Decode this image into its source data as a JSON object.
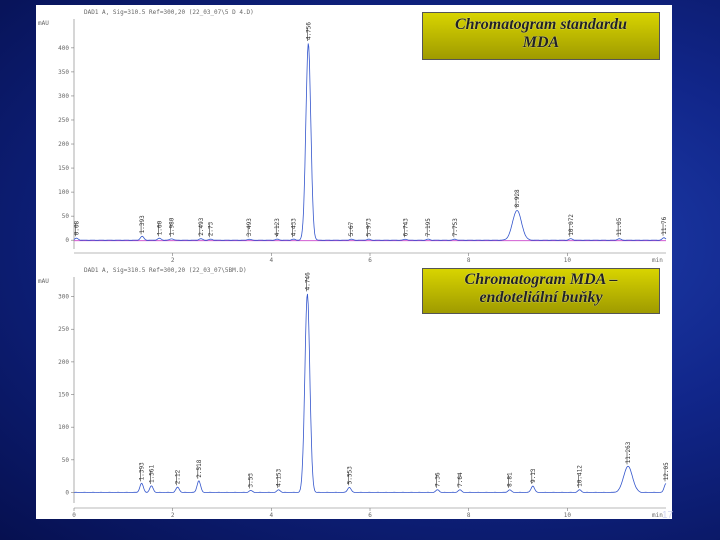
{
  "chart_data": [
    {
      "type": "line",
      "header": "DAD1 A, Sig=310.5 Ref=300,20 (22_03_07\\5 D 4.D)",
      "ylabel": "mAU",
      "yticks": [
        0,
        50,
        100,
        150,
        200,
        250,
        300,
        350,
        400
      ],
      "ylim": [
        -10,
        460
      ],
      "xticks": [
        2,
        4,
        6,
        8,
        10
      ],
      "xlim": [
        0,
        12
      ],
      "xunit": "min",
      "baseline_color": "#cc44cc",
      "series": [
        {
          "color": "#3355cc",
          "peaks": [
            {
              "rt": 0.05,
              "height": 4,
              "label": "0.08"
            },
            {
              "rt": 1.38,
              "height": 8,
              "label": "1.393"
            },
            {
              "rt": 1.73,
              "height": 4,
              "label": "1.60"
            },
            {
              "rt": 1.98,
              "height": 3,
              "label": "1.980"
            },
            {
              "rt": 2.57,
              "height": 3,
              "label": "2.493"
            },
            {
              "rt": 2.77,
              "height": 2,
              "label": "2.73"
            },
            {
              "rt": 3.55,
              "height": 2,
              "label": "3.493"
            },
            {
              "rt": 4.12,
              "height": 2,
              "label": "4.123"
            },
            {
              "rt": 4.45,
              "height": 2,
              "label": "4.433"
            },
            {
              "rt": 4.75,
              "height": 410,
              "label": "4.756"
            },
            {
              "rt": 5.62,
              "height": 2,
              "label": "5.67"
            },
            {
              "rt": 5.97,
              "height": 2,
              "label": "5.973"
            },
            {
              "rt": 6.72,
              "height": 2,
              "label": "6.743"
            },
            {
              "rt": 7.18,
              "height": 2,
              "label": "7.195"
            },
            {
              "rt": 7.72,
              "height": 2,
              "label": "7.753"
            },
            {
              "rt": 8.98,
              "height": 62,
              "label": "8.928"
            },
            {
              "rt": 10.07,
              "height": 3,
              "label": "10.072"
            },
            {
              "rt": 11.05,
              "height": 3,
              "label": "11.05"
            },
            {
              "rt": 11.96,
              "height": 5,
              "label": "11.76"
            }
          ]
        }
      ],
      "caption_lines": [
        "Chromatogram standardu",
        "MDA"
      ]
    },
    {
      "type": "line",
      "header": "DAD1 A, Sig=310.5 Ref=300,20 (22_03_07\\5BM.D)",
      "ylabel": "mAU",
      "yticks": [
        0,
        50,
        100,
        150,
        200,
        250,
        300
      ],
      "ylim": [
        -10,
        330
      ],
      "xticks": [
        0,
        2,
        4,
        6,
        8,
        10
      ],
      "xlim": [
        0,
        12
      ],
      "xunit": "min",
      "series": [
        {
          "color": "#3355cc",
          "peaks": [
            {
              "rt": 1.37,
              "height": 14,
              "label": "1.393"
            },
            {
              "rt": 1.57,
              "height": 10,
              "label": "1.561"
            },
            {
              "rt": 2.1,
              "height": 8,
              "label": "2.12"
            },
            {
              "rt": 2.53,
              "height": 18,
              "label": "2.518"
            },
            {
              "rt": 3.58,
              "height": 3,
              "label": "3.53"
            },
            {
              "rt": 4.15,
              "height": 4,
              "label": "4.153"
            },
            {
              "rt": 4.73,
              "height": 305,
              "label": "4.746"
            },
            {
              "rt": 5.58,
              "height": 8,
              "label": "5.553"
            },
            {
              "rt": 7.37,
              "height": 4,
              "label": "7.36"
            },
            {
              "rt": 7.82,
              "height": 4,
              "label": "7.64"
            },
            {
              "rt": 8.83,
              "height": 4,
              "label": "8.81"
            },
            {
              "rt": 9.3,
              "height": 10,
              "label": "9.13"
            },
            {
              "rt": 10.25,
              "height": 4,
              "label": "10.412"
            },
            {
              "rt": 11.23,
              "height": 40,
              "label": "11.263"
            },
            {
              "rt": 12.0,
              "height": 14,
              "label": "12.05"
            }
          ]
        }
      ],
      "caption_lines": [
        "Chromatogram MDA –",
        "endoteliální buňky"
      ]
    }
  ],
  "slide": {
    "number": "17"
  }
}
